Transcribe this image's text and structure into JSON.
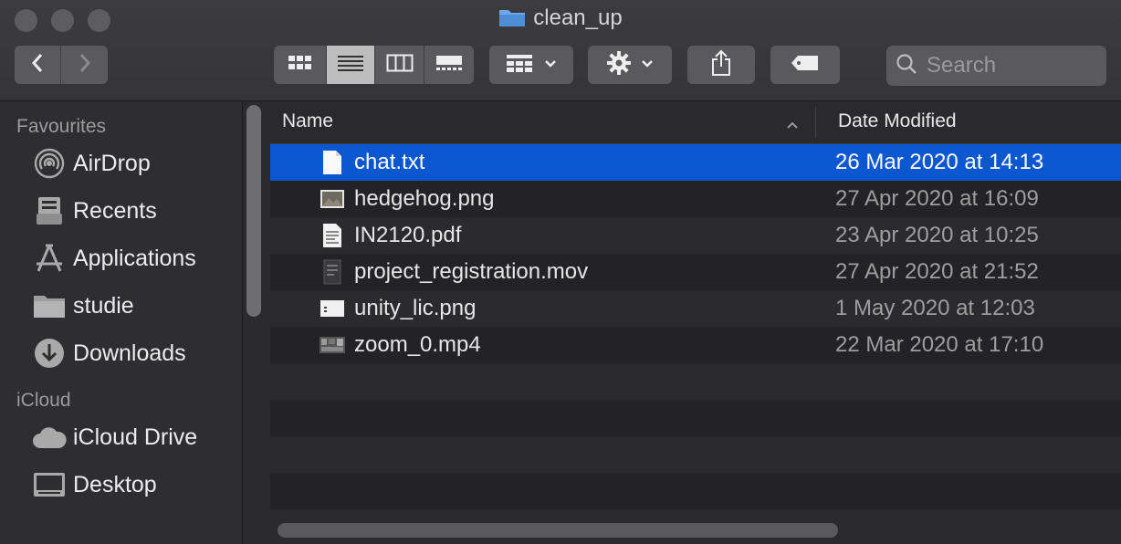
{
  "window": {
    "title": "clean_up"
  },
  "toolbar": {
    "back_icon": "chevron-left-icon",
    "forward_icon": "chevron-right-icon",
    "view_modes": [
      "icon-view",
      "list-view",
      "column-view",
      "gallery-view"
    ],
    "active_view": "list-view",
    "group_icon": "group-by-icon",
    "action_icon": "gear-icon",
    "share_icon": "share-icon",
    "tag_icon": "tag-icon",
    "search": {
      "placeholder": "Search",
      "value": ""
    }
  },
  "sidebar": {
    "sections": [
      {
        "title": "Favourites",
        "items": [
          {
            "label": "AirDrop",
            "icon": "airdrop-icon"
          },
          {
            "label": "Recents",
            "icon": "recents-icon"
          },
          {
            "label": "Applications",
            "icon": "applications-icon"
          },
          {
            "label": "studie",
            "icon": "folder-icon"
          },
          {
            "label": "Downloads",
            "icon": "downloads-icon"
          }
        ]
      },
      {
        "title": "iCloud",
        "items": [
          {
            "label": "iCloud Drive",
            "icon": "icloud-icon"
          },
          {
            "label": "Desktop",
            "icon": "desktop-icon"
          }
        ]
      }
    ]
  },
  "list": {
    "columns": {
      "name": "Name",
      "date": "Date Modified"
    },
    "files": [
      {
        "name": "chat.txt",
        "date": "26 Mar 2020 at 14:13",
        "icon": "text-file-icon",
        "selected": true
      },
      {
        "name": "hedgehog.png",
        "date": "27 Apr 2020 at 16:09",
        "icon": "image-file-icon",
        "selected": false
      },
      {
        "name": "IN2120.pdf",
        "date": "23 Apr 2020 at 10:25",
        "icon": "pdf-file-icon",
        "selected": false
      },
      {
        "name": "project_registration.mov",
        "date": "27 Apr 2020 at 21:52",
        "icon": "video-file-icon",
        "selected": false
      },
      {
        "name": "unity_lic.png",
        "date": "1 May 2020 at 12:03",
        "icon": "image-file-icon",
        "selected": false
      },
      {
        "name": "zoom_0.mp4",
        "date": "22 Mar 2020 at 17:10",
        "icon": "video-file-icon",
        "selected": false
      }
    ]
  },
  "colors": {
    "selection": "#0b57d0",
    "window_bg": "#2b2b2d",
    "toolbar_button": "#5a5a5d"
  }
}
